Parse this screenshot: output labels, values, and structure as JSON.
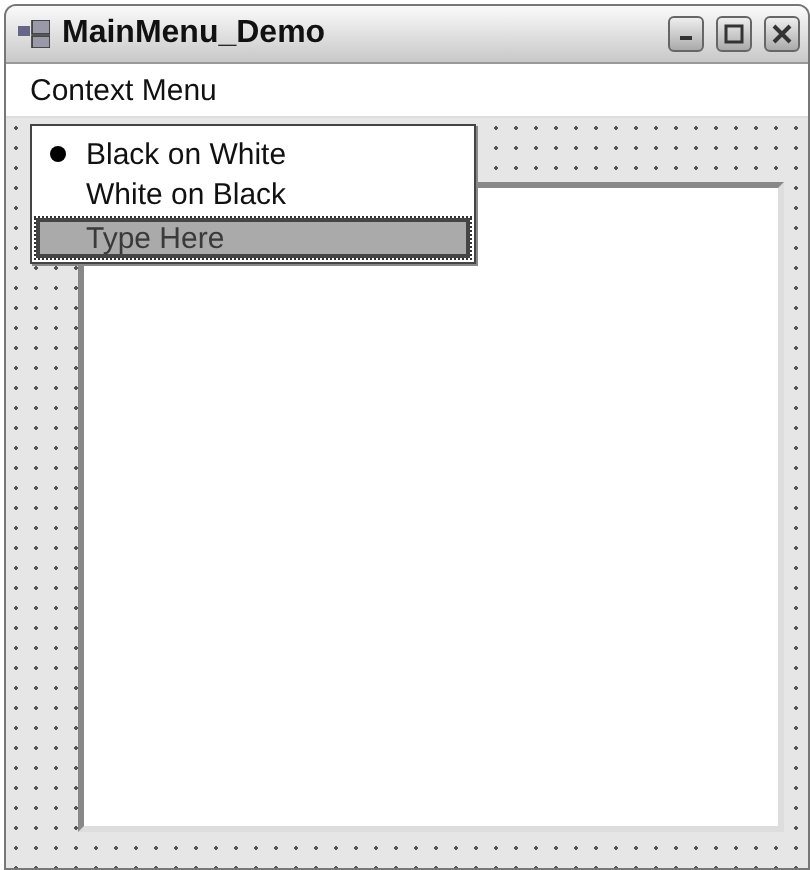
{
  "window": {
    "title": "MainMenu_Demo"
  },
  "menu_bar": [
    {
      "label": "Context Menu"
    }
  ],
  "dropdown": {
    "items": [
      {
        "label": "Black on White",
        "selected": true
      },
      {
        "label": "White on Black",
        "selected": false
      }
    ],
    "new_item": {
      "placeholder": "Type Here"
    }
  }
}
